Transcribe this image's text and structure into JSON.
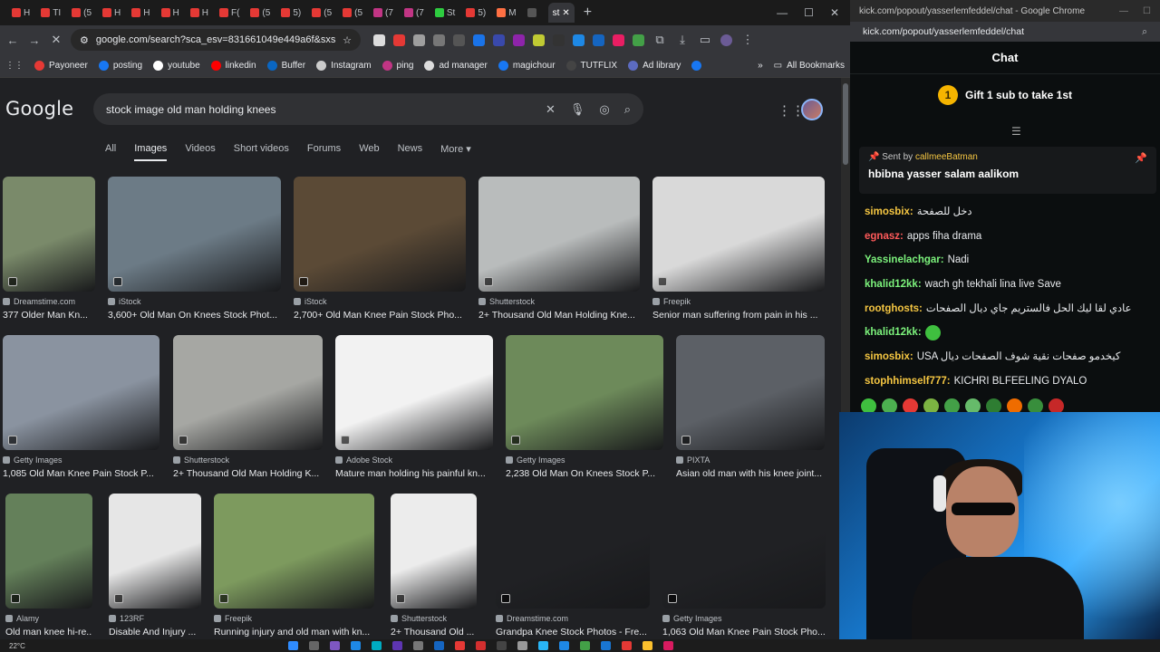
{
  "browser": {
    "tabs": [
      "H",
      "TI",
      "(5",
      "H",
      "H",
      "H",
      "H",
      "F(",
      "(5",
      "5)",
      "(5",
      "(5",
      "(7",
      "(7",
      "St",
      "5)",
      "M",
      "",
      "st"
    ],
    "omnibox_url": "google.com/search?sca_esv=831661049e449a6f&sxsrf=AE3T...",
    "bookmarks": [
      "Payoneer",
      "posting",
      "youtube",
      "linkedin",
      "Buffer",
      "Instagram",
      "ping",
      "ad manager",
      "magichour",
      "TUTFLIX",
      "Ad library"
    ],
    "all_bookmarks": "All Bookmarks"
  },
  "google": {
    "logo": "Google",
    "query": "stock image old man holding knees",
    "tabs": [
      "All",
      "Images",
      "Videos",
      "Short videos",
      "Forums",
      "Web",
      "News",
      "More"
    ],
    "results": [
      {
        "source": "Dreamstime.com",
        "title": "377 Older Man Kn...",
        "color": "#7a8a6a"
      },
      {
        "source": "iStock",
        "title": "3,600+ Old Man On Knees Stock Phot...",
        "color": "#6c7b86"
      },
      {
        "source": "iStock",
        "title": "2,700+ Old Man Knee Pain Stock Pho...",
        "color": "#5b4a36"
      },
      {
        "source": "Shutterstock",
        "title": "2+ Thousand Old Man Holding Kne...",
        "color": "#b9bcbc"
      },
      {
        "source": "Freepik",
        "title": "Senior man suffering from pain in his ...",
        "color": "#d9d9d9"
      },
      {
        "source": "Getty Images",
        "title": "1,085 Old Man Knee Pain Stock P...",
        "color": "#8a93a0"
      },
      {
        "source": "Shutterstock",
        "title": "2+ Thousand Old Man Holding K...",
        "color": "#a6a7a3"
      },
      {
        "source": "Adobe Stock",
        "title": "Mature man holding his painful kn...",
        "color": "#f2f2f2"
      },
      {
        "source": "Getty Images",
        "title": "2,238 Old Man On Knees Stock P...",
        "color": "#6d8a5a"
      },
      {
        "source": "PIXTA",
        "title": "Asian old man with his knee joint...",
        "color": "#5c6066"
      },
      {
        "source": "Alamy",
        "title": "Old man knee hi-re...",
        "color": "#64805a"
      },
      {
        "source": "123RF",
        "title": "Disable And Injury ...",
        "color": "#e6e6e6"
      },
      {
        "source": "Freepik",
        "title": "Running injury and old man with kn...",
        "color": "#7d9a5e"
      },
      {
        "source": "Shutterstock",
        "title": "2+ Thousand Old ...",
        "color": "#ececec"
      },
      {
        "source": "Dreamstime.com",
        "title": "Grandpa Knee Stock Photos - Fre...",
        "color": "#202124"
      },
      {
        "source": "Getty Images",
        "title": "1,063 Old Man Knee Pain Stock Pho...",
        "color": "#202124"
      }
    ]
  },
  "kick": {
    "window_title": "kick.com/popout/yasserlemfeddel/chat - Google Chrome",
    "url": "kick.com/popout/yasserlemfeddel/chat",
    "header": "Chat",
    "gift_label": "Gift 1 sub to take 1st",
    "gift_count": "1",
    "pinned_prefix": "Sent by",
    "pinned_user": "callmeeBatman",
    "pinned_message": "hbibna yasser salam aalikom",
    "messages": [
      {
        "user": "simosbix:",
        "text": "دخل للصفحة",
        "color": "#f5c642"
      },
      {
        "user": "egnasz:",
        "text": "apps fiha drama",
        "color": "#ff5a5a"
      },
      {
        "user": "Yassinelachgar:",
        "text": "Nadi",
        "color": "#7cf27c"
      },
      {
        "user": "khalid12kk:",
        "text": "wach gh tekhali lina live Save",
        "color": "#7cf27c"
      },
      {
        "user": "rootghosts:",
        "text": "عادي لقا ليك الحل فالستريم جاي ديال الصفحات",
        "color": "#f5c642"
      },
      {
        "user": "khalid12kk:",
        "text": "",
        "color": "#7cf27c"
      },
      {
        "user": "simosbix:",
        "text": "USA كيخدمو صفحات نقية  شوف الصفحات ديال",
        "color": "#f5c642"
      },
      {
        "user": "stophhimself777:",
        "text": "KICHRI BLFEELING DYALO",
        "color": "#f5c642"
      }
    ]
  },
  "taskbar": {
    "weather": "22°C"
  }
}
